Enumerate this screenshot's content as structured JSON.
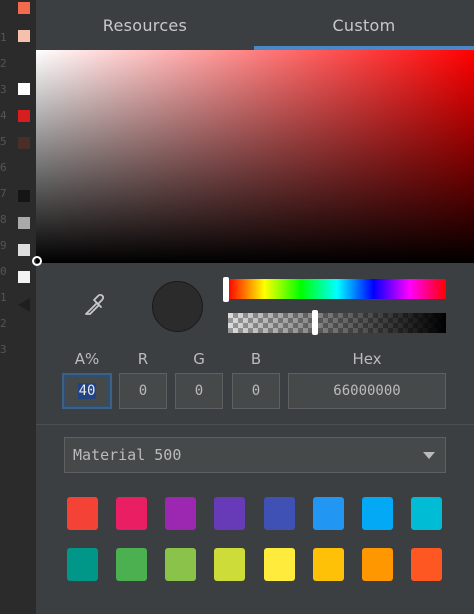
{
  "gutter": {
    "line_numbers": [
      "1",
      "2",
      "3",
      "4",
      "5",
      "6",
      "7",
      "8",
      "9",
      "0",
      "1",
      "2",
      "3"
    ],
    "swatch_colors": [
      "#f26b4f",
      "#f7c0ad",
      "#ffffff",
      "#d71d1d",
      "#4a2e28",
      "#151515",
      "#aaaaaa",
      "#dddddd",
      "#f2f2f2"
    ]
  },
  "tabs": [
    {
      "label": "Resources",
      "selected": false
    },
    {
      "label": "Custom",
      "selected": true
    }
  ],
  "picker": {
    "hue_color": "#ff0000",
    "preview_color": "#2b2b2b"
  },
  "fields": {
    "alpha": {
      "label": "A%",
      "value": "40"
    },
    "r": {
      "label": "R",
      "value": "0"
    },
    "g": {
      "label": "G",
      "value": "0"
    },
    "b": {
      "label": "B",
      "value": "0"
    },
    "hex": {
      "label": "Hex",
      "value": "66000000"
    }
  },
  "palette": {
    "selected": "Material 500",
    "row1": [
      "#f44336",
      "#e91e63",
      "#9c27b0",
      "#673ab7",
      "#3f51b5",
      "#2196f3",
      "#03a9f4",
      "#00bcd4"
    ],
    "row2": [
      "#009688",
      "#4caf50",
      "#8bc34a",
      "#cddc39",
      "#ffeb3b",
      "#ffc107",
      "#ff9800",
      "#ff5722"
    ]
  },
  "icons": {
    "eyedropper": "eyedropper-icon",
    "dropdown_caret": "chevron-down-icon"
  }
}
